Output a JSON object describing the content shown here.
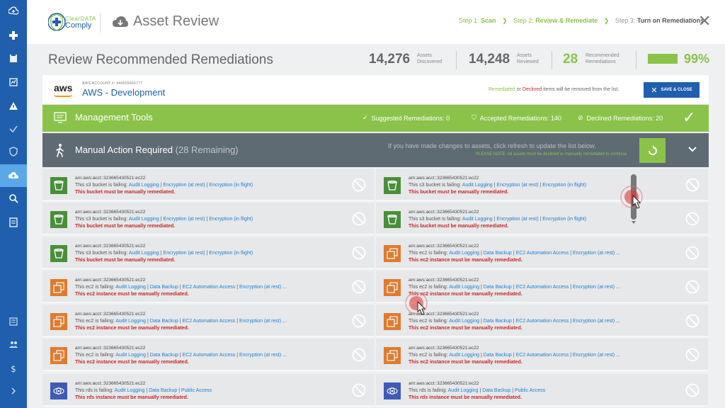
{
  "sidebar": {
    "icons": [
      "cloud-shield-icon",
      "medical-cross-icon",
      "clipboard-icon",
      "report-icon",
      "alert-icon",
      "check-icon",
      "shield-icon",
      "cloud-upload-icon",
      "search-icon",
      "document-icon",
      "list-icon",
      "users-icon",
      "dollar-icon",
      "chevron-right-icon"
    ],
    "active": "cloud-upload-icon"
  },
  "header": {
    "logo_line1": "ClearDATA",
    "logo_line2": "Comply",
    "title": "Asset Review",
    "steps": [
      {
        "prefix": "Step 1:",
        "label": "Scan"
      },
      {
        "prefix": "Step 2:",
        "label": "Review & Remediate"
      },
      {
        "prefix": "Step 3:",
        "label": "Turn on Remediations"
      }
    ],
    "close": "✕"
  },
  "summary": {
    "title": "Review Recommended Remediations",
    "discovered": "14,276",
    "discovered_label1": "Assets",
    "discovered_label2": "Discovered",
    "reviewed": "14,248",
    "reviewed_label1": "Assets",
    "reviewed_label2": "Reviewed",
    "recommended": "28",
    "recommended_label1": "Recommended",
    "recommended_label2": "Remediations",
    "progress_pct": 99,
    "progress_text": "99%"
  },
  "account": {
    "logo": "aws",
    "label": "AWS ACCOUNT #: 444555666777",
    "name": "AWS - Development",
    "note_remediated": "Remediated",
    "note_or": " or ",
    "note_declined": "Declined",
    "note_rest": " items will be removed from the list.",
    "save_label": "SAVE & CLOSE"
  },
  "management": {
    "title": "Management Tools",
    "suggested": "Suggested Remediations: 0",
    "accepted": "Accepted Remediations: 140",
    "declined": "Declined Remediations: 20"
  },
  "manual": {
    "title": "Manual Action Required",
    "remaining": "(28 Remaining)",
    "note": "If you have made changes to assets, click refresh to update the list below.",
    "please_note": "PLEASE NOTE: All assets must be declined or manually remediated to continue."
  },
  "assets_left": [
    {
      "type": "s3",
      "arn": "arn:aws:acct::323665430521:ec22",
      "prefix": "This s3 bucket is failing:",
      "checks": [
        "Audit Logging",
        "Encryption (at rest)",
        "Encryption (in flight)"
      ],
      "more": "",
      "msg": "This bucket must be manually remediated."
    },
    {
      "type": "s3",
      "arn": "arn:aws:acct::323665430521:ec22",
      "prefix": "This s3 bucket is failing:",
      "checks": [
        "Audit Logging",
        "Encryption (at rest)",
        "Encryption (in flight)"
      ],
      "more": "",
      "msg": "This bucket must be manually remediated."
    },
    {
      "type": "s3",
      "arn": "arn:aws:acct::323665430521:ec22",
      "prefix": "This s3 bucket is failing:",
      "checks": [
        "Audit Logging",
        "Encryption (at rest)",
        "Encryption (in flight)"
      ],
      "more": "",
      "msg": "This bucket must be manually remediated."
    },
    {
      "type": "ec2",
      "arn": "arn:aws:acct::323665430521:ec22",
      "prefix": "This ec2 is failing:",
      "checks": [
        "Audit Logging",
        "Data Backup",
        "EC2 Automation Access",
        "Encryption (at rest)"
      ],
      "more": "...",
      "msg": "This ec2 instance must be manually remediated."
    },
    {
      "type": "ec2",
      "arn": "arn:aws:acct::323665430521:ec22",
      "prefix": "This ec2 is failing:",
      "checks": [
        "Audit Logging",
        "Data Backup",
        "EC2 Automation Access",
        "Encryption (at rest)"
      ],
      "more": "...",
      "msg": "This ec2 instance must be manually remediated."
    },
    {
      "type": "ec2",
      "arn": "arn:aws:acct::323665430521:ec22",
      "prefix": "This ec2 is failing:",
      "checks": [
        "Audit Logging",
        "Data Backup",
        "EC2 Automation Access",
        "Encryption (at rest)"
      ],
      "more": "...",
      "msg": "This ec2 instance must be manually remediated."
    },
    {
      "type": "rds",
      "arn": "arn:aws:acct::323665430521:ec22",
      "prefix": "This rds is failing:",
      "checks": [
        "Audit Logging",
        "Data Backup",
        "Public Access"
      ],
      "more": "",
      "msg": "This rds instance must be manually remediated."
    }
  ],
  "assets_right": [
    {
      "type": "s3",
      "arn": "arn:aws:acct::323665430521:ec22",
      "prefix": "This s3 bucket is failing:",
      "checks": [
        "Audit Logging",
        "Encryption (at rest)",
        "Encryption (in flight)"
      ],
      "more": "",
      "msg": "This bucket must be manually remediated."
    },
    {
      "type": "s3",
      "arn": "arn:aws:acct::323665430521:ec22",
      "prefix": "This s3 bucket is failing:",
      "checks": [
        "Audit Logging",
        "Encryption (at rest)",
        "Encryption (in flight)"
      ],
      "more": "",
      "msg": "This bucket must be manually remediated."
    },
    {
      "type": "ec2",
      "arn": "arn:aws:acct::323665430521:ec22",
      "prefix": "This ec2 is failing:",
      "checks": [
        "Audit Logging",
        "Data Backup",
        "EC2 Automation Access",
        "Encryption (at rest)"
      ],
      "more": "...",
      "msg": "This ec2 instance must be manually remediated."
    },
    {
      "type": "ec2",
      "arn": "arn:aws:acct::323665430521:ec22",
      "prefix": "This ec2 is failing:",
      "checks": [
        "Audit Logging",
        "Data Backup",
        "EC2 Automation Access",
        "Encryption (at rest)"
      ],
      "more": "...",
      "msg": "This ec2 instance must be manually remediated."
    },
    {
      "type": "ec2",
      "arn": "arn:aws:acct::323665430521:ec22",
      "prefix": "This ec2 is failing:",
      "checks": [
        "Audit Logging",
        "Data Backup",
        "EC2 Automation Access",
        "Encryption (at rest)"
      ],
      "more": "...",
      "msg": "This ec2 instance must be manually remediated."
    },
    {
      "type": "ec2",
      "arn": "arn:aws:acct::323665430521:ec22",
      "prefix": "This ec2 is failing:",
      "checks": [
        "Audit Logging",
        "Data Backup",
        "EC2 Automation Access",
        "Encryption (at rest)"
      ],
      "more": "...",
      "msg": "This ec2 instance must be manually remediated."
    },
    {
      "type": "rds",
      "arn": "arn:aws:acct::323665430521:ec22",
      "prefix": "This rds is failing:",
      "checks": [
        "Audit Logging",
        "Data Backup",
        "Public Access"
      ],
      "more": "",
      "msg": "This rds instance must be manually remediated."
    }
  ],
  "colors": {
    "sidebar": "#1f5fae",
    "sidebar_active": "#5aa8e8",
    "accent_green": "#8bc34a",
    "dark_bar": "#5f6b73",
    "link_blue": "#1f7fd0",
    "error_red": "#c62828"
  }
}
